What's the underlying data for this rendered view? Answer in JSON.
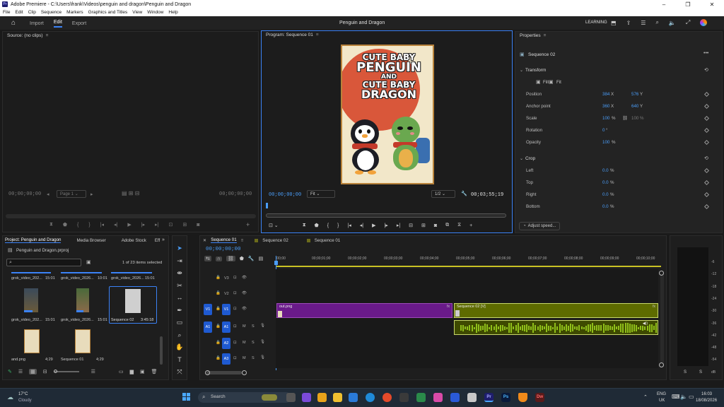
{
  "window": {
    "title": "Adobe Premiere - C:\\Users\\frank\\Videos\\penguin and dragon\\Penguin and Dragon",
    "app_icon": "Pr"
  },
  "menu": [
    "File",
    "Edit",
    "Clip",
    "Sequence",
    "Markers",
    "Graphics and Titles",
    "View",
    "Window",
    "Help"
  ],
  "header": {
    "tabs": [
      "Import",
      "Edit",
      "Export"
    ],
    "active_tab": "Edit",
    "project_title": "Penguin and Dragon",
    "workspace": "LEARNING"
  },
  "source_panel": {
    "title": "Source: (no clips)",
    "timecode_left": "00;00;00;00",
    "page_label": "Page 1",
    "timecode_right": "00;00;00;00"
  },
  "program_panel": {
    "title": "Program: Sequence 01",
    "timecode_left": "00;00;00;00",
    "fit": "Fit",
    "resolution": "1/2",
    "timecode_right": "00;03;55;19",
    "poster": {
      "line1": "CUTE BABY",
      "line2": "PENGUIN",
      "line3": "AND",
      "line4": "CUTE BABY",
      "line5": "DRAGON"
    }
  },
  "properties_panel": {
    "title": "Properties",
    "sequence_name": "Sequence 02",
    "transform_label": "Transform",
    "fill_label": "Fill",
    "fit_label": "Fit",
    "rows": [
      {
        "label": "Position",
        "v1": "384",
        "u1": "X",
        "v2": "576",
        "u2": "Y"
      },
      {
        "label": "Anchor point",
        "v1": "360",
        "u1": "X",
        "v2": "640",
        "u2": "Y"
      },
      {
        "label": "Scale",
        "v1": "100",
        "u1": "%",
        "v2": "100",
        "u2": "%"
      },
      {
        "label": "Rotation",
        "v1": "0",
        "u1": "°",
        "v2": "",
        "u2": ""
      },
      {
        "label": "Opacity",
        "v1": "100",
        "u1": "%",
        "v2": "",
        "u2": ""
      }
    ],
    "crop_label": "Crop",
    "crop_rows": [
      {
        "label": "Left",
        "value": "0.0",
        "unit": "%"
      },
      {
        "label": "Top",
        "value": "0.0",
        "unit": "%"
      },
      {
        "label": "Right",
        "value": "0.0",
        "unit": "%"
      },
      {
        "label": "Bottom",
        "value": "0.0",
        "unit": "%"
      }
    ],
    "adjust_speed": "Adjust speed..."
  },
  "project_panel": {
    "tabs": [
      "Project: Penguin and Dragon",
      "Media Browser",
      "Adobe Stock",
      "Eff"
    ],
    "file": "Penguin and Dragon.prproj",
    "selection_info": "1 of 23 items selected",
    "items": [
      {
        "name": "grok_video_202...",
        "duration": "15:01"
      },
      {
        "name": "grok_video_2026...",
        "duration": "10:01"
      },
      {
        "name": "grok_video_2026...",
        "duration": "15:01"
      },
      {
        "name": "grok_video_202...",
        "duration": "15:01"
      },
      {
        "name": "grok_video_2026...",
        "duration": "15:01"
      },
      {
        "name": "Sequence 02",
        "duration": "3:45:18"
      },
      {
        "name": "and.png",
        "duration": "4;29"
      },
      {
        "name": "Sequence 01",
        "duration": "4;29"
      }
    ]
  },
  "timeline": {
    "tabs": [
      "Sequence 01",
      "Sequence 02",
      "Sequence 01"
    ],
    "timecode": "00;00;00;00",
    "ruler": [
      ":00;00",
      "00;00;01;00",
      "00;00;02;00",
      "00;00;03;00",
      "00;00;04;00",
      "00;00;05;00",
      "00;00;06;00",
      "00;00;07;00",
      "00;00;08;00",
      "00;00;09;00",
      "00;00;10;00"
    ],
    "tracks": [
      "V3",
      "V2",
      "V1",
      "A1",
      "A2",
      "A3"
    ],
    "clip_video1": "out.png",
    "clip_video2": "Sequence 02 [V]",
    "fx_badge": "fx"
  },
  "audio_meter": {
    "labels": [
      "-6",
      "-12",
      "-18",
      "-24",
      "-30",
      "-36",
      "-42",
      "-48",
      "-54",
      "dB"
    ],
    "bottom": [
      "S",
      "S"
    ]
  },
  "taskbar": {
    "weather_temp": "17°C",
    "weather_desc": "Cloudy",
    "search_placeholder": "Search",
    "lang_top": "ENG",
    "lang_bottom": "UK",
    "time": "16:03",
    "date": "18/08/2026"
  },
  "colors": {
    "accent_blue": "#3b82f6",
    "clip_purple": "#6a1a8a",
    "clip_olive": "#5e6b00",
    "audio_green": "#8fbf1a"
  }
}
